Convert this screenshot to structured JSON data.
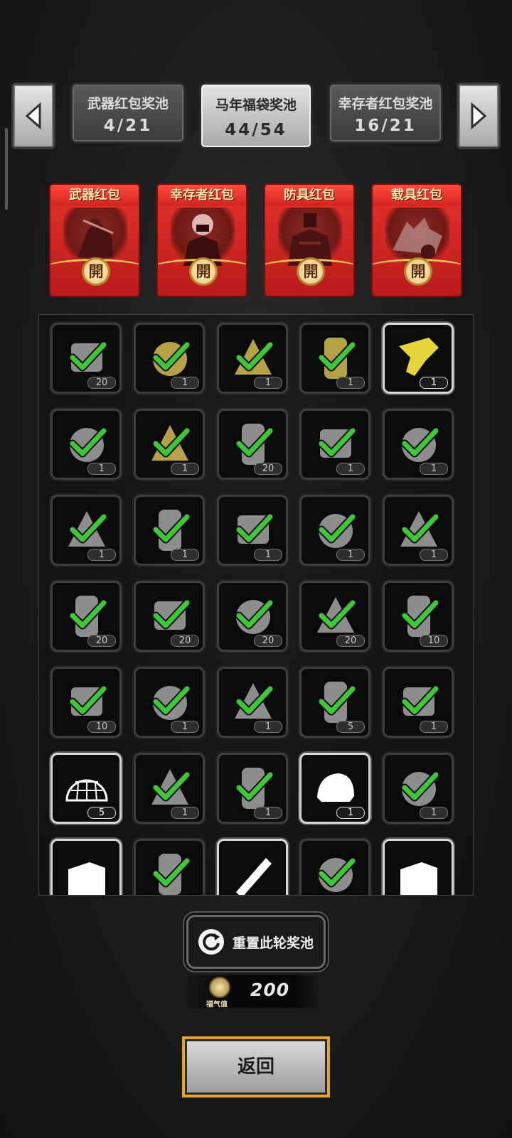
{
  "pools": [
    {
      "name": "武器红包奖池",
      "count": "4/21",
      "active": false
    },
    {
      "name": "马年福袋奖池",
      "count": "44/54",
      "active": true
    },
    {
      "name": "幸存者红包奖池",
      "count": "16/21",
      "active": false
    }
  ],
  "envelopes": [
    {
      "title": "武器红包",
      "seal": "開",
      "icon": "weapon-figure-icon"
    },
    {
      "title": "幸存者红包",
      "seal": "開",
      "icon": "survivor-figure-icon"
    },
    {
      "title": "防具红包",
      "seal": "開",
      "icon": "armor-figure-icon"
    },
    {
      "title": "载具红包",
      "seal": "開",
      "icon": "vehicle-figure-icon"
    }
  ],
  "items": [
    {
      "icon": "pickaxe-icon",
      "qty": "20",
      "checked": true,
      "highlight": false
    },
    {
      "icon": "flask-icon",
      "qty": "1",
      "checked": true,
      "highlight": false
    },
    {
      "icon": "scrap-pile-icon",
      "qty": "1",
      "checked": true,
      "highlight": false
    },
    {
      "icon": "wood-planks-icon",
      "qty": "1",
      "checked": true,
      "highlight": false
    },
    {
      "icon": "golden-gun-icon",
      "qty": "1",
      "checked": false,
      "highlight": true
    },
    {
      "icon": "map-icon",
      "qty": "1",
      "checked": true,
      "highlight": false
    },
    {
      "icon": "golden-staff-icon",
      "qty": "1",
      "checked": true,
      "highlight": false
    },
    {
      "icon": "cash-bundle-icon",
      "qty": "20",
      "checked": true,
      "highlight": false
    },
    {
      "icon": "ingots-icon",
      "qty": "1",
      "checked": true,
      "highlight": false
    },
    {
      "icon": "vase-icon",
      "qty": "1",
      "checked": true,
      "highlight": false
    },
    {
      "icon": "ring-icon",
      "qty": "1",
      "checked": true,
      "highlight": false
    },
    {
      "icon": "food-bowl-icon",
      "qty": "1",
      "checked": true,
      "highlight": false
    },
    {
      "icon": "coffee-cup-icon",
      "qty": "1",
      "checked": true,
      "highlight": false
    },
    {
      "icon": "fruit-bowl-icon",
      "qty": "1",
      "checked": true,
      "highlight": false
    },
    {
      "icon": "gift-basket-icon",
      "qty": "1",
      "checked": true,
      "highlight": false
    },
    {
      "icon": "battery-icon",
      "qty": "20",
      "checked": true,
      "highlight": false
    },
    {
      "icon": "bullets-icon",
      "qty": "20",
      "checked": true,
      "highlight": false
    },
    {
      "icon": "fuel-barrel-icon",
      "qty": "20",
      "checked": true,
      "highlight": false
    },
    {
      "icon": "rifle-ammo-icon",
      "qty": "20",
      "checked": true,
      "highlight": false
    },
    {
      "icon": "shotgun-shells-icon",
      "qty": "10",
      "checked": true,
      "highlight": false
    },
    {
      "icon": "magazine-icon",
      "qty": "10",
      "checked": true,
      "highlight": false
    },
    {
      "icon": "drink-cup-icon",
      "qty": "1",
      "checked": true,
      "highlight": false
    },
    {
      "icon": "jar-icon",
      "qty": "1",
      "checked": true,
      "highlight": false
    },
    {
      "icon": "globe-net-icon",
      "qty": "5",
      "checked": true,
      "highlight": false
    },
    {
      "icon": "juice-glass-icon",
      "qty": "1",
      "checked": true,
      "highlight": false
    },
    {
      "icon": "net-trap-icon",
      "qty": "5",
      "checked": false,
      "highlight": true
    },
    {
      "icon": "blade-icon",
      "qty": "1",
      "checked": true,
      "highlight": false
    },
    {
      "icon": "cloth-stack-icon",
      "qty": "1",
      "checked": true,
      "highlight": false
    },
    {
      "icon": "bread-icon",
      "qty": "1",
      "checked": false,
      "highlight": true
    },
    {
      "icon": "medicine-bottle-icon",
      "qty": "1",
      "checked": true,
      "highlight": false
    },
    {
      "icon": "boot-icon",
      "qty": "",
      "checked": false,
      "highlight": true
    },
    {
      "icon": "bag-icon",
      "qty": "",
      "checked": true,
      "highlight": false
    },
    {
      "icon": "syringe-icon",
      "qty": "",
      "checked": false,
      "highlight": true
    },
    {
      "icon": "tool-icon",
      "qty": "",
      "checked": true,
      "highlight": false
    },
    {
      "icon": "boot-icon",
      "qty": "",
      "checked": false,
      "highlight": true
    }
  ],
  "reset": {
    "label": "重置此轮奖池"
  },
  "luck": {
    "label": "福气值",
    "value": "200"
  },
  "back": {
    "label": "返回"
  },
  "colors": {
    "check": "#3fc73a",
    "envelope_red": "#e8322c",
    "gold": "#e0a52a"
  }
}
